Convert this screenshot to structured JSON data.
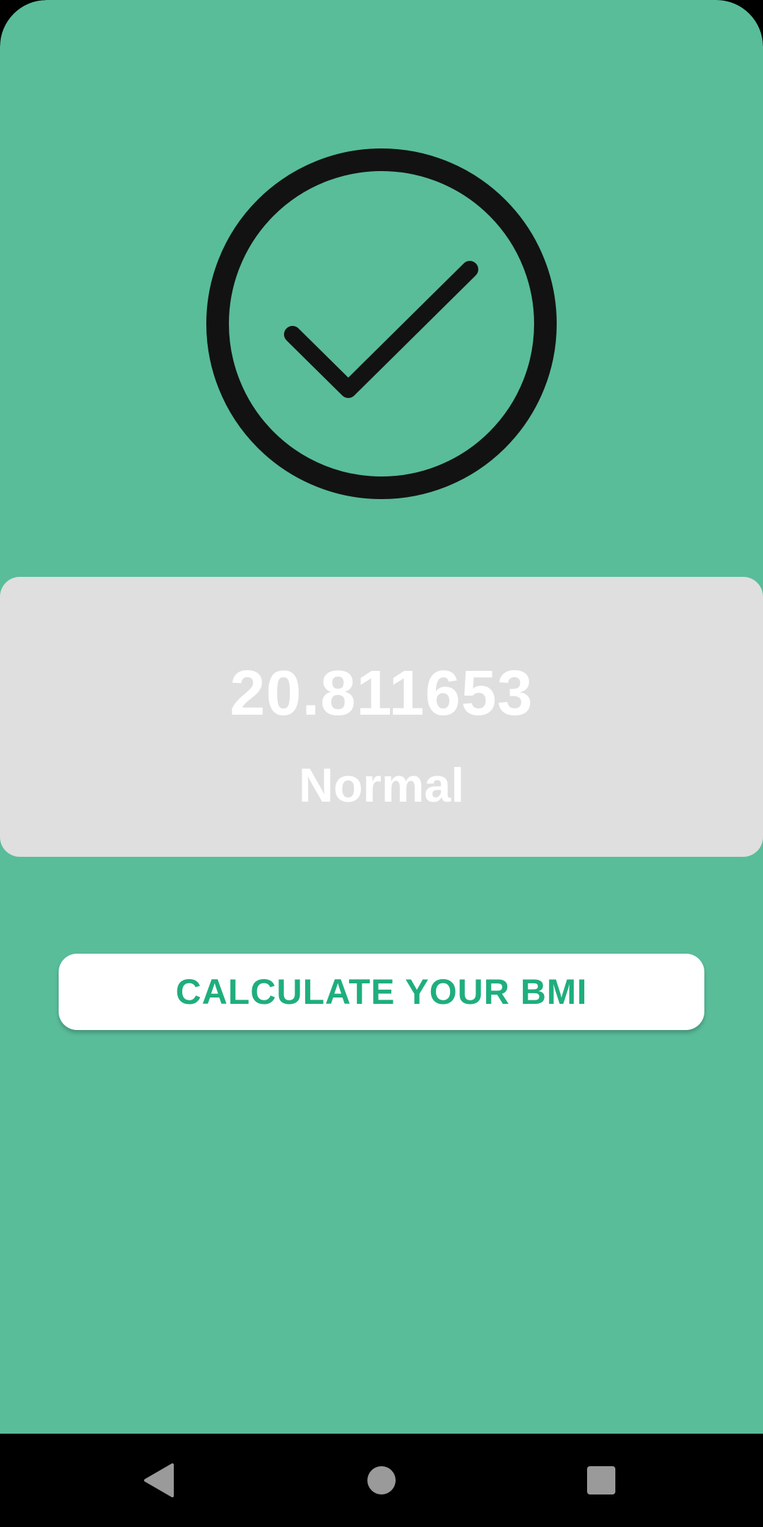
{
  "result": {
    "status_icon": "check-circle-icon",
    "bmi_value": "20.811653",
    "category": "Normal"
  },
  "actions": {
    "calculate_label": "CALCULATE YOUR BMI"
  },
  "navbar": {
    "back_icon": "back-triangle-icon",
    "home_icon": "home-circle-icon",
    "recents_icon": "recents-square-icon"
  },
  "colors": {
    "background": "#59bd9a",
    "card": "#dfdfdf",
    "accent_text": "#1fae7c",
    "icon_stroke": "#121212"
  }
}
